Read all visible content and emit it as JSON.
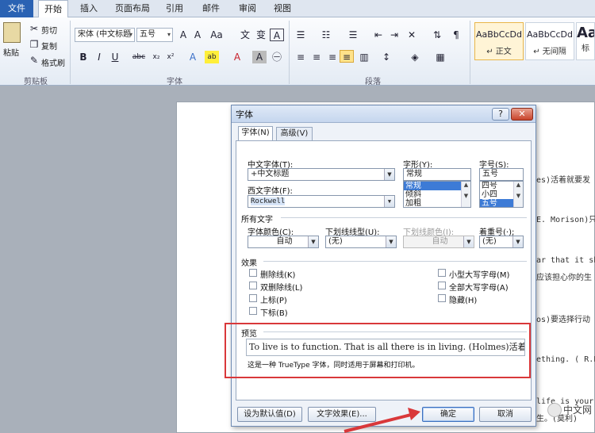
{
  "tabs": {
    "file": "文件",
    "items": [
      "开始",
      "插入",
      "页面布局",
      "引用",
      "邮件",
      "审阅",
      "视图"
    ]
  },
  "ribbon": {
    "paste": "粘贴",
    "cut": "剪切",
    "copy": "复制",
    "format_painter": "格式刷",
    "font_name": "宋体 (中文标题",
    "font_size": "五号",
    "groups": {
      "clipboard": "剪贴板",
      "font": "字体",
      "paragraph": "段落"
    },
    "styles": [
      {
        "sample": "AaBbCcDd",
        "name": "↵ 正文"
      },
      {
        "sample": "AaBbCcDd",
        "name": "↵ 无间隔"
      },
      {
        "sample": "Aa",
        "name": "标"
      }
    ]
  },
  "document": {
    "lines": [
      "es)活着就要发",
      "E. Morison)只",
      "ar that it sh",
      "应该担心你的生",
      "os)要选择行动",
      "ething. ( R.E",
      "life is your",
      "生。(莫利)"
    ]
  },
  "dialog": {
    "title": "字体",
    "help": "?",
    "close": "✕",
    "tabs": [
      "字体(N)",
      "高级(V)"
    ],
    "cn_font_label": "中文字体(T):",
    "cn_font_value": "+中文标题",
    "west_font_label": "西文字体(F):",
    "west_font_value": "Rockwell",
    "style_label": "字形(Y):",
    "style_value": "常规",
    "style_list": [
      "常规",
      "倾斜",
      "加粗"
    ],
    "size_label": "字号(S):",
    "size_value": "五号",
    "size_list": [
      "四号",
      "小四",
      "五号"
    ],
    "all_text": "所有文字",
    "color_label": "字体颜色(C):",
    "color_value": "自动",
    "underline_label": "下划线线型(U):",
    "underline_value": "(无)",
    "underline_color_label": "下划线颜色(I):",
    "underline_color_value": "自动",
    "emphasis_label": "着重号(·);",
    "emphasis_value": "(无)",
    "effects": "效果",
    "effects_left": [
      "删除线(K)",
      "双删除线(L)",
      "上标(P)",
      "下标(B)"
    ],
    "effects_right": [
      "小型大写字母(M)",
      "全部大写字母(A)",
      "隐藏(H)"
    ],
    "preview_label": "预览",
    "preview_text": "To live is to function. That is all there is in living. (Holmes)活着就",
    "preview_note": "这是一种 TrueType 字体，同时适用于屏幕和打印机。",
    "btn_default": "设为默认值(D)",
    "btn_effects": "文字效果(E)...",
    "btn_ok": "确定",
    "btn_cancel": "取消"
  },
  "watermark": "中文网",
  "colors": {
    "file_tab": "#2a62b3",
    "highlight_box": "#d9383a",
    "selection": "#3d7bd6"
  }
}
